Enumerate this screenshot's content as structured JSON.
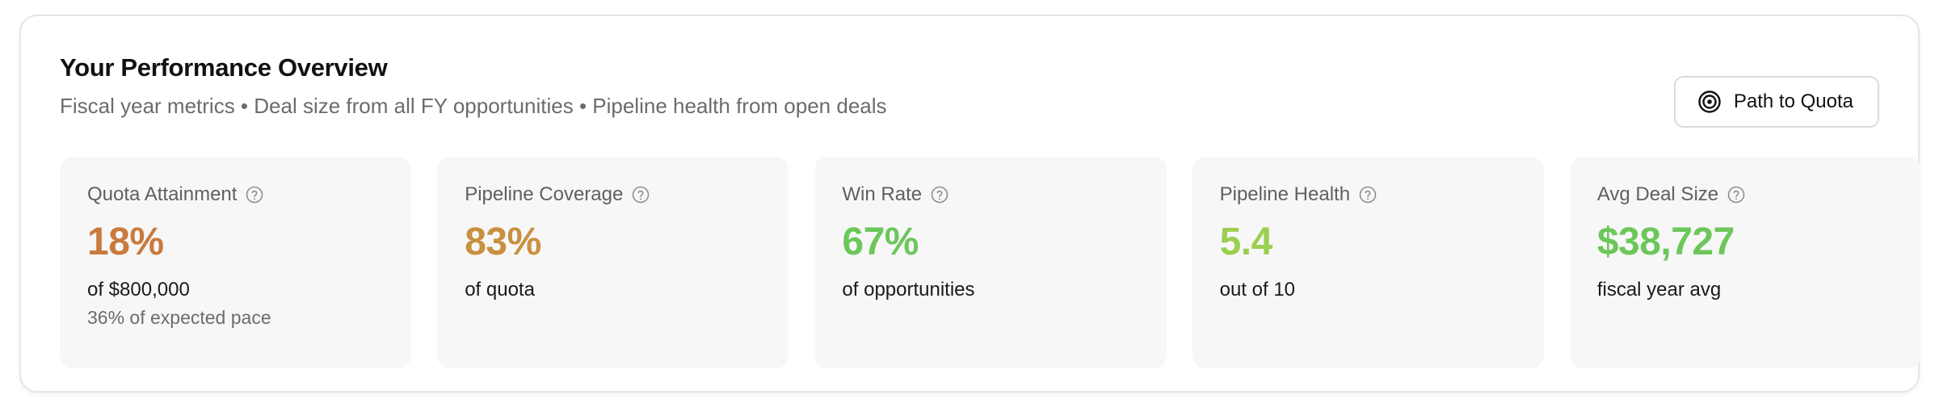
{
  "header": {
    "title": "Your Performance Overview",
    "subtitle": "Fiscal year metrics • Deal size from all FY opportunities • Pipeline health from open deals"
  },
  "actions": {
    "path_to_quota": {
      "label": "Path to Quota",
      "icon": "target-icon"
    }
  },
  "metrics": [
    {
      "label": "Quota Attainment",
      "value": "18%",
      "description": "of $800,000",
      "sub": "36% of expected pace",
      "color": "#c97a3d"
    },
    {
      "label": "Pipeline Coverage",
      "value": "83%",
      "description": "of quota",
      "sub": "",
      "color": "#c9913f"
    },
    {
      "label": "Win Rate",
      "value": "67%",
      "description": "of opportunities",
      "sub": "",
      "color": "#6cc75a"
    },
    {
      "label": "Pipeline Health",
      "value": "5.4",
      "description": "out of 10",
      "sub": "",
      "color": "#9ccf4f"
    },
    {
      "label": "Avg Deal Size",
      "value": "$38,727",
      "description": "fiscal year avg",
      "sub": "",
      "color": "#6cc75a"
    }
  ]
}
